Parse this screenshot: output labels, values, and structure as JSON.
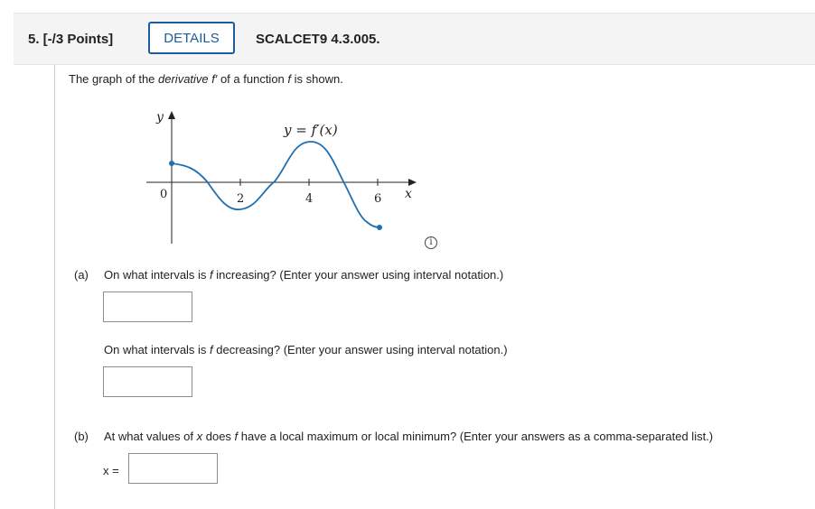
{
  "header": {
    "question_number": "5. [-/3 Points]",
    "details_label": "DETAILS",
    "question_id": "SCALCET9 4.3.005."
  },
  "intro": {
    "prefix": "The graph of the ",
    "derivative_word": "derivative",
    "fprime": "f′",
    "middle": " of a function ",
    "f": "f",
    "suffix": " is shown."
  },
  "graph": {
    "y_axis_label": "y",
    "x_axis_label": "x",
    "curve_label": "y = f′(x)",
    "origin_label": "0",
    "tick_labels": [
      "2",
      "4",
      "6"
    ]
  },
  "info_icon": "info-icon",
  "part_a": {
    "tag": "(a)",
    "q1_prefix": "On what intervals is ",
    "q1_f": "f",
    "q1_suffix": " increasing? (Enter your answer using interval notation.)",
    "q2_prefix": "On what intervals is ",
    "q2_f": "f",
    "q2_suffix": " decreasing? (Enter your answer using interval notation.)"
  },
  "part_b": {
    "tag": "(b)",
    "prefix": "At what values of ",
    "x": "x",
    "middle": " does ",
    "f": "f",
    "suffix": " have a local maximum or local minimum? (Enter your answers as a comma-separated list.)",
    "answer_label": "x ="
  },
  "colors": {
    "accent": "#1a5d9a",
    "curve": "#1f6fb2"
  }
}
